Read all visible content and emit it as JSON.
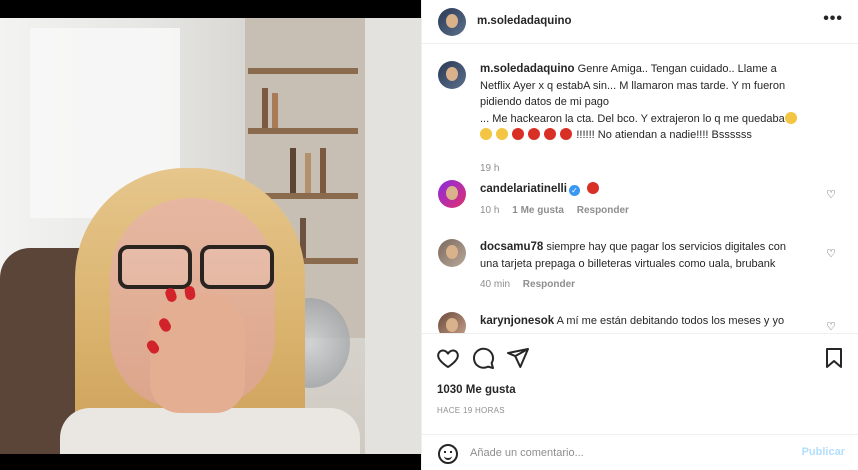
{
  "post": {
    "username": "m.soledadaquino",
    "more_icon": "more-horizontal-icon"
  },
  "caption": {
    "username": "m.soledadaquino",
    "text_line1": "Genre Amiga.. Tengan cuidado.. Llame a",
    "text_line2": "Netflix Ayer x q estabA sin... M llamaron mas tarde. Y m fueron",
    "text_line3": "pidiendo datos de mi pago",
    "text_line4": "... Me hackearon la cta. Del bco. Y extrajeron lo q me quedaba",
    "text_line5_tail": "!!!!!! No atiendan a nadie!!!! Bssssss",
    "time": "19 h"
  },
  "comments": [
    {
      "username": "candelariatinelli",
      "text": "",
      "time": "10 h",
      "likes": "1 Me gusta",
      "reply": "Responder"
    },
    {
      "username": "docsamu78",
      "text_line1": "siempre hay que pagar los servicios digitales con",
      "text_line2": "una tarjeta prepaga o billeteras virtuales como uala, brubank",
      "time": "40 min",
      "reply": "Responder"
    },
    {
      "username": "karynjonesok",
      "text_line1": "A mí me están debitando todos los meses y yo"
    }
  ],
  "actions": {
    "likes_count": "1030 Me gusta",
    "posted_ago": "HACE 19 HORAS"
  },
  "add_comment": {
    "placeholder": "Añade un comentario...",
    "publish_label": "Publicar"
  },
  "colors": {
    "accent": "#3897f0",
    "publish_disabled": "#b2dffc",
    "angry_emoji": "#d93025",
    "sad_emoji": "#f4c542"
  }
}
